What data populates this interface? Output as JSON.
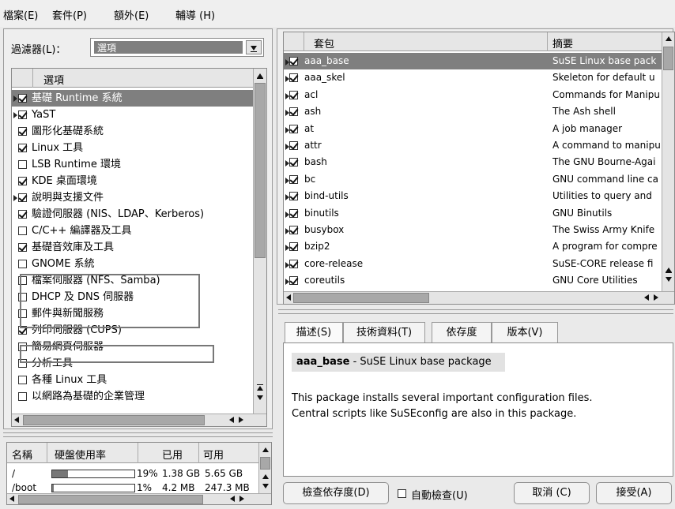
{
  "menu": [
    "檔案(E)",
    "套件(P)",
    "額外(E)",
    "輔導 (H)"
  ],
  "filter": {
    "label": "過濾器(L)：",
    "value": "選項"
  },
  "patterns": {
    "header": "選項",
    "items": [
      {
        "label": "基礎 Runtime 系統",
        "checked": true,
        "arrow": true,
        "selected": true
      },
      {
        "label": "YaST",
        "checked": true,
        "arrow": true
      },
      {
        "label": "圖形化基礎系統",
        "checked": true
      },
      {
        "label": "Linux 工具",
        "checked": true
      },
      {
        "label": "LSB Runtime 環境",
        "checked": false
      },
      {
        "label": "KDE 桌面環境",
        "checked": true
      },
      {
        "label": "說明與支援文件",
        "checked": true,
        "arrow": true
      },
      {
        "label": "驗證伺服器 (NIS、LDAP、Kerberos)",
        "checked": true
      },
      {
        "label": "C/C++ 編譯器及工具",
        "checked": false
      },
      {
        "label": "基礎音效庫及工具",
        "checked": true
      },
      {
        "label": "GNOME 系統",
        "checked": false
      },
      {
        "label": "檔案伺服器 (NFS、Samba)",
        "checked": false
      },
      {
        "label": "DHCP 及 DNS 伺服器",
        "checked": false
      },
      {
        "label": "郵件與新聞服務",
        "checked": false
      },
      {
        "label": "列印伺服器 (CUPS)",
        "checked": true
      },
      {
        "label": "簡易網頁伺服器",
        "checked": false
      },
      {
        "label": "分析工具",
        "checked": false
      },
      {
        "label": "各種 Linux 工具",
        "checked": false
      },
      {
        "label": "以網路為基礎的企業管理",
        "checked": false
      }
    ]
  },
  "disk": {
    "headers": [
      "名稱",
      "硬盤使用率",
      "已用",
      "可用"
    ],
    "rows": [
      {
        "name": "/",
        "percent": "19%",
        "fill": 0.19,
        "used": "1.38 GB",
        "free": "5.65 GB"
      },
      {
        "name": "/boot",
        "percent": "1%",
        "fill": 0.01,
        "used": "4.2 MB",
        "free": "247.3 MB"
      }
    ]
  },
  "packages": {
    "headers": [
      "套包",
      "摘要"
    ],
    "rows": [
      {
        "name": "aaa_base",
        "summary": "SuSE Linux base pack",
        "selected": true
      },
      {
        "name": "aaa_skel",
        "summary": "Skeleton for default u"
      },
      {
        "name": "acl",
        "summary": "Commands for Manipu"
      },
      {
        "name": "ash",
        "summary": "The Ash shell"
      },
      {
        "name": "at",
        "summary": "A job manager"
      },
      {
        "name": "attr",
        "summary": "A command to manipu"
      },
      {
        "name": "bash",
        "summary": "The GNU Bourne-Agai"
      },
      {
        "name": "bc",
        "summary": "GNU command line ca"
      },
      {
        "name": "bind-utils",
        "summary": "Utilities to query and"
      },
      {
        "name": "binutils",
        "summary": "GNU Binutils"
      },
      {
        "name": "busybox",
        "summary": "The Swiss Army Knife"
      },
      {
        "name": "bzip2",
        "summary": "A program for compre"
      },
      {
        "name": "core-release",
        "summary": "SuSE-CORE release fi"
      },
      {
        "name": "coreutils",
        "summary": "GNU Core Utilities"
      }
    ]
  },
  "tabs": [
    "描述(S)",
    "技術資料(T)",
    "依存度",
    "版本(V)"
  ],
  "description": {
    "name": "aaa_base",
    "title_rest": " - SuSE Linux base package",
    "body": "This package installs several important configuration files. Central scripts like SuSEconfig are also in this package."
  },
  "buttons": {
    "check_deps": "檢查依存度(D)",
    "auto_check": "自動檢查(U)",
    "cancel": "取消 (C)",
    "accept": "接受(A)"
  }
}
